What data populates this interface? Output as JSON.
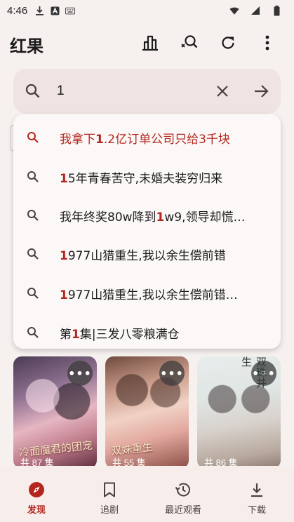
{
  "status_bar": {
    "time": "4:46"
  },
  "app_bar": {
    "title": "红果"
  },
  "search": {
    "query": "1"
  },
  "suggestions": [
    {
      "pre": "我拿下",
      "hl": "1",
      "post": ".2亿订单公司只给3千块",
      "active": true
    },
    {
      "pre": "",
      "hl": "1",
      "post": "5年青春苦守,未婚夫装穷归来",
      "active": false
    },
    {
      "pre": "我年终奖80w降到",
      "hl": "1",
      "post": "w9,领导却慌…",
      "active": false
    },
    {
      "pre": "",
      "hl": "1",
      "post": "977山猎重生,我以余生偿前错",
      "active": false
    },
    {
      "pre": "",
      "hl": "1",
      "post": "977山猎重生,我以余生偿前错…",
      "active": false
    },
    {
      "pre": "第",
      "hl": "1",
      "post": "集|三发八零粮满仓",
      "active": false
    }
  ],
  "covers": [
    {
      "title": "冷面魔君的团宠",
      "episodes": "共 87 集",
      "more": "•••"
    },
    {
      "title": "双姝重生",
      "episodes": "共 55 集",
      "more": "•••"
    },
    {
      "title": "双珠并生",
      "episodes": "共 86 集",
      "more": "•••"
    }
  ],
  "bottom_nav": [
    {
      "label": "发现",
      "icon": "compass-icon",
      "active": true
    },
    {
      "label": "追剧",
      "icon": "bookmark-icon",
      "active": false
    },
    {
      "label": "最近观看",
      "icon": "history-icon",
      "active": false
    },
    {
      "label": "下载",
      "icon": "download-icon",
      "active": false
    }
  ],
  "colors": {
    "accent": "#b3261e",
    "background": "#f6f1ef",
    "search_bg": "#efe4e1"
  }
}
